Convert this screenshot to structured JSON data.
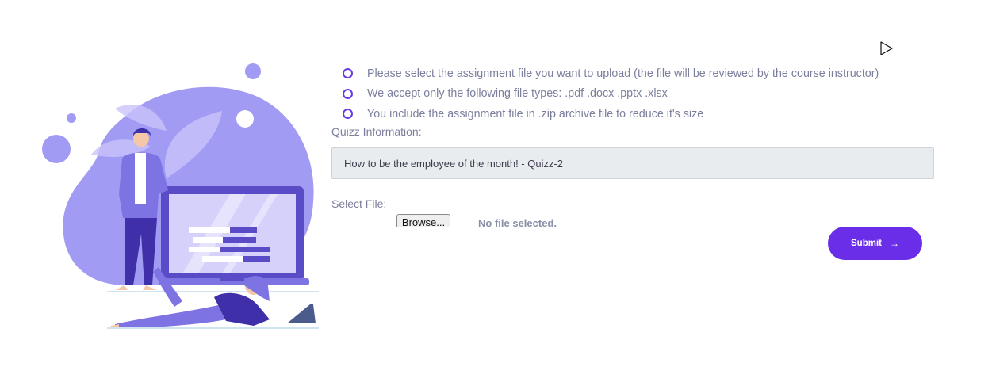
{
  "instructions": [
    "Please select the assignment file you want to upload (the file will be reviewed by the course instructor)",
    "We accept only the following file types: .pdf .docx .pptx .xlsx",
    "You include the assignment file in .zip archive file to reduce it's size"
  ],
  "quiz": {
    "label": "Quizz Information:",
    "value": "How to be the employee of the month! - Quizz-2"
  },
  "file": {
    "label": "Select File:",
    "browse_label": "Browse...",
    "status": "No file selected."
  },
  "submit": {
    "label": "Submit",
    "icon": "arrow-right-icon"
  },
  "colors": {
    "accent": "#6a2ee8",
    "illustration": "#a29bf4",
    "text": "#7b7f9c"
  }
}
